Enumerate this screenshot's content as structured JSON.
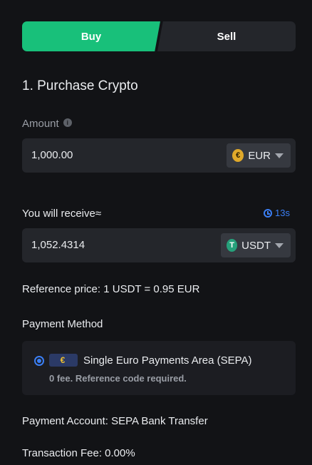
{
  "tabs": {
    "buy": "Buy",
    "sell": "Sell",
    "active": "Buy"
  },
  "section": {
    "title": "1. Purchase Crypto"
  },
  "amount": {
    "label": "Amount",
    "info_icon": "info-icon",
    "value": "1,000.00",
    "currency": "EUR",
    "currency_icon": "euro-coin-icon",
    "currency_symbol": "€"
  },
  "receive": {
    "label": "You will receive≈",
    "timer": "13s",
    "timer_icon": "clock-icon",
    "value": "1,052.4314",
    "currency": "USDT",
    "currency_icon": "tether-coin-icon",
    "currency_symbol": "T"
  },
  "reference_price": "Reference price: 1 USDT = 0.95 EUR",
  "payment_method": {
    "label": "Payment Method",
    "option": {
      "name": "Single Euro Payments Area (SEPA)",
      "description": "0 fee. Reference code required.",
      "selected": true,
      "logo_symbol": "€"
    }
  },
  "payment_account": "Payment Account: SEPA Bank Transfer",
  "transaction_fee": "Transaction Fee: 0.00%",
  "colors": {
    "background": "#121316",
    "buy_accent": "#18c07a",
    "link_blue": "#3b7ff5",
    "field_bg": "#24262b"
  }
}
